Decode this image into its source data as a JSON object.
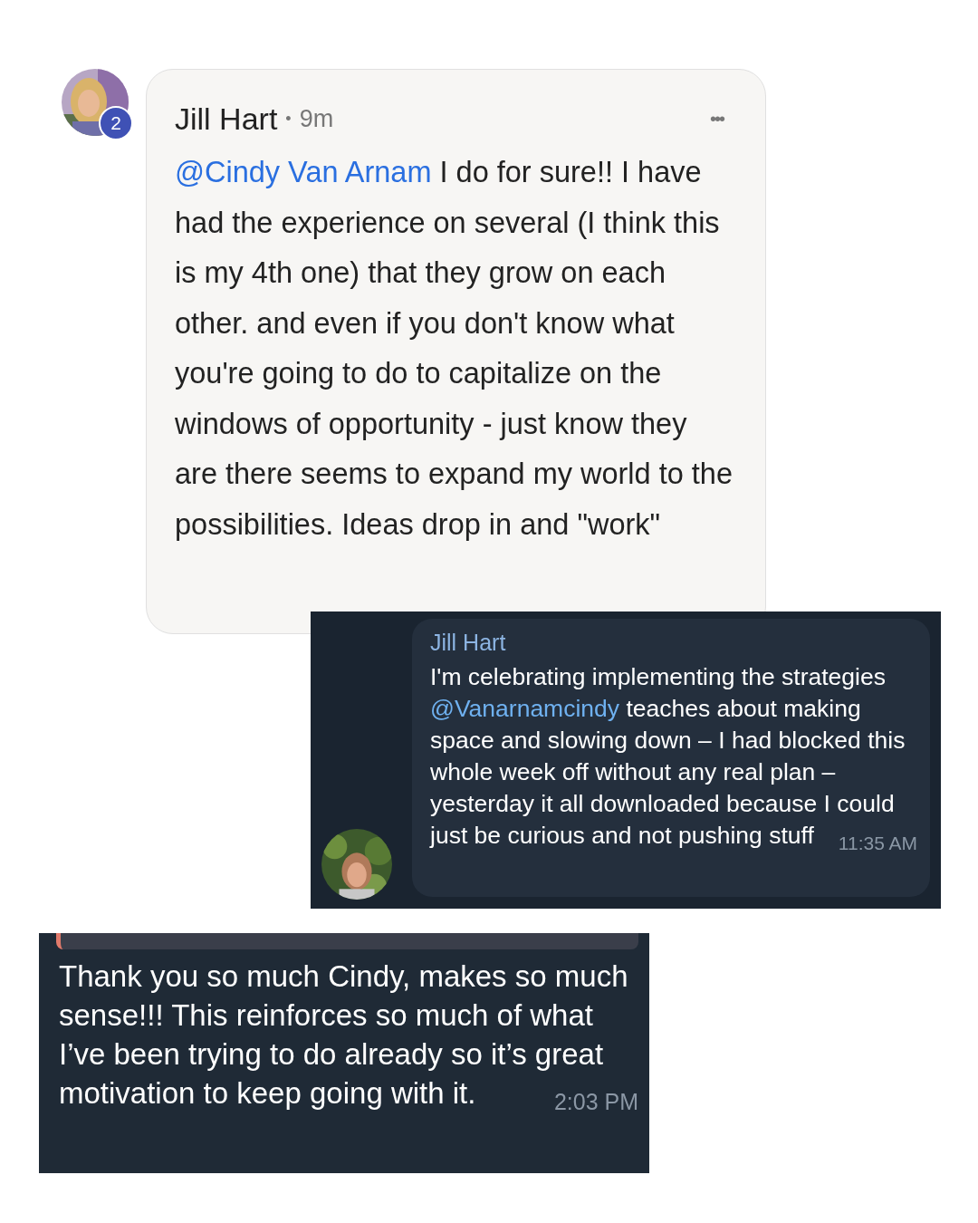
{
  "comment": {
    "author": "Jill Hart",
    "separator": "•",
    "time": "9m",
    "badge": "2",
    "menu": "•••",
    "mention": "@Cindy Van Arnam",
    "text": "I do for sure!! I have had the experience on several (I think this is my 4th one) that they grow on each other. and even if you don't know what you're going to do to capitalize on the windows of opportunity - just know they are there seems to expand my world to the possibilities. Ideas drop in and \"work\""
  },
  "chat_message": {
    "author": "Jill Hart",
    "before": "I'm celebrating implementing the strategies",
    "mention": "@Vanarnamcindy",
    "after": "teaches about making space and slowing down – I had blocked this whole week off without any real plan – yesterday it all downloaded because I could just be curious and not pushing stuff",
    "time": "11:35 AM"
  },
  "reply_message": {
    "text": "Thank you so much Cindy, makes so much sense!!! This reinforces so much of what I’ve been trying to do already so it’s great motivation to keep going with it.",
    "time": "2:03 PM"
  }
}
